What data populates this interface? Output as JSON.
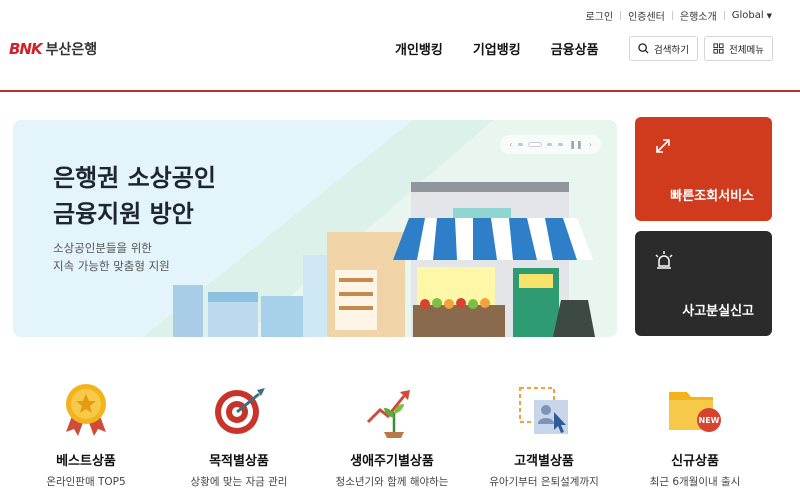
{
  "utility": {
    "login": "로그인",
    "cert": "인증센터",
    "about": "은행소개",
    "global": "Global"
  },
  "brand": {
    "mark": "BNK",
    "name": "부산은행",
    "color": "#d0202a"
  },
  "gnb": [
    "개인뱅킹",
    "기업뱅킹",
    "금융상품"
  ],
  "header_buttons": {
    "search": "검색하기",
    "menu": "전체메뉴"
  },
  "banner": {
    "title_line1": "은행권 소상공인",
    "title_line2": "금융지원 방안",
    "sub_line1": "소상공인분들을 위한",
    "sub_line2": "지속 가능한 맞춤형 지원",
    "pager": {
      "prev": "‹",
      "next": "›",
      "pause": "❚❚"
    }
  },
  "quick": [
    {
      "label": "빠른조회서비스",
      "icon": "arrows-swap-icon",
      "color": "#d03a1d"
    },
    {
      "label": "사고분실신고",
      "icon": "siren-icon",
      "color": "#2b2b2b"
    }
  ],
  "products": [
    {
      "title": "베스트상품",
      "sub": "온라인판매 TOP5",
      "icon": "medal-icon"
    },
    {
      "title": "목적별상품",
      "sub": "상황에 맞는 자금 관리",
      "icon": "target-icon"
    },
    {
      "title": "생애주기별상품",
      "sub": "청소년기와 함께 해야하는",
      "icon": "growth-plant-icon"
    },
    {
      "title": "고객별상품",
      "sub": "유아기부터 은퇴설계까지",
      "icon": "customer-profile-icon"
    },
    {
      "title": "신규상품",
      "sub": "최근 6개월이내 출시",
      "icon": "new-folder-icon",
      "badge": "NEW"
    }
  ]
}
